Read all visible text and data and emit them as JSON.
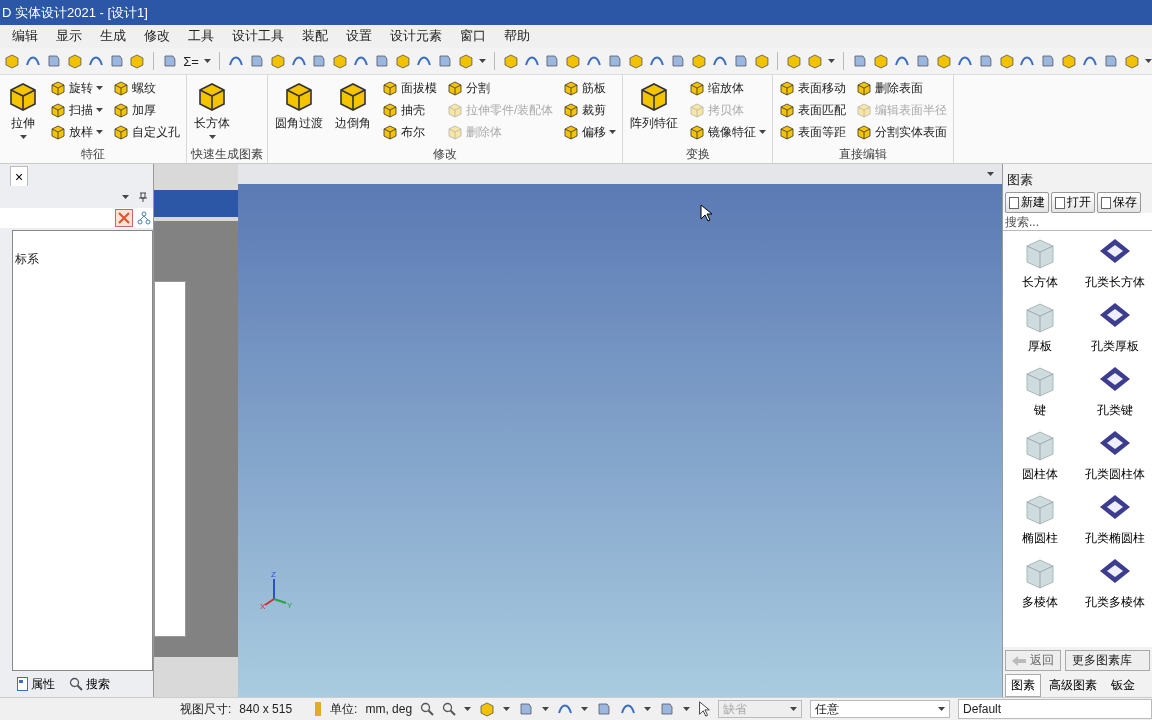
{
  "window": {
    "title": "D 实体设计2021 - [设计1]"
  },
  "menu": [
    "编辑",
    "显示",
    "生成",
    "修改",
    "工具",
    "设计工具",
    "装配",
    "设置",
    "设计元素",
    "窗口",
    "帮助"
  ],
  "toolbar": {
    "sigma_label": "Σ="
  },
  "ribbon": [
    {
      "label": "特征",
      "columns": [
        {
          "kind": "big",
          "items": [
            {
              "label": "拉伸",
              "dropdown": true,
              "disabled": false
            }
          ]
        },
        {
          "kind": "small",
          "items": [
            {
              "label": "旋转",
              "dropdown": true,
              "disabled": false
            },
            {
              "label": "扫描",
              "dropdown": true,
              "disabled": false
            },
            {
              "label": "放样",
              "dropdown": true,
              "disabled": false
            }
          ]
        },
        {
          "kind": "small",
          "items": [
            {
              "label": "螺纹",
              "dropdown": false,
              "disabled": false
            },
            {
              "label": "加厚",
              "dropdown": false,
              "disabled": false
            },
            {
              "label": "自定义孔",
              "dropdown": false,
              "disabled": false
            }
          ]
        }
      ]
    },
    {
      "label": "快速生成图素",
      "columns": [
        {
          "kind": "big",
          "items": [
            {
              "label": "长方体",
              "dropdown": true,
              "disabled": false
            }
          ]
        }
      ]
    },
    {
      "label": "修改",
      "columns": [
        {
          "kind": "big",
          "items": [
            {
              "label": "圆角过渡",
              "dropdown": false,
              "disabled": false
            }
          ]
        },
        {
          "kind": "big",
          "items": [
            {
              "label": "边倒角",
              "dropdown": false,
              "disabled": false
            }
          ]
        },
        {
          "kind": "small",
          "items": [
            {
              "label": "面拔模",
              "dropdown": false,
              "disabled": false
            },
            {
              "label": "抽壳",
              "dropdown": false,
              "disabled": false
            },
            {
              "label": "布尔",
              "dropdown": false,
              "disabled": false
            }
          ]
        },
        {
          "kind": "small",
          "items": [
            {
              "label": "分割",
              "dropdown": false,
              "disabled": false
            },
            {
              "label": "拉伸零件/装配体",
              "dropdown": false,
              "disabled": true
            },
            {
              "label": "删除体",
              "dropdown": false,
              "disabled": true
            }
          ]
        },
        {
          "kind": "small",
          "items": [
            {
              "label": "筋板",
              "dropdown": false,
              "disabled": false
            },
            {
              "label": "裁剪",
              "dropdown": false,
              "disabled": false
            },
            {
              "label": "偏移",
              "dropdown": true,
              "disabled": false
            }
          ]
        }
      ]
    },
    {
      "label": "变换",
      "columns": [
        {
          "kind": "big",
          "items": [
            {
              "label": "阵列特征",
              "dropdown": false,
              "disabled": false
            }
          ]
        },
        {
          "kind": "small",
          "items": [
            {
              "label": "缩放体",
              "dropdown": false,
              "disabled": false
            },
            {
              "label": "拷贝体",
              "dropdown": false,
              "disabled": true
            },
            {
              "label": "镜像特征",
              "dropdown": true,
              "disabled": false
            }
          ]
        }
      ]
    },
    {
      "label": "直接编辑",
      "columns": [
        {
          "kind": "small",
          "items": [
            {
              "label": "表面移动",
              "dropdown": false,
              "disabled": false
            },
            {
              "label": "表面匹配",
              "dropdown": false,
              "disabled": false
            },
            {
              "label": "表面等距",
              "dropdown": false,
              "disabled": false
            }
          ]
        },
        {
          "kind": "small",
          "items": [
            {
              "label": "删除表面",
              "dropdown": false,
              "disabled": false
            },
            {
              "label": "编辑表面半径",
              "dropdown": false,
              "disabled": true
            },
            {
              "label": "分割实体表面",
              "dropdown": false,
              "disabled": false
            }
          ]
        }
      ]
    }
  ],
  "left_panel": {
    "close": "×",
    "tree_items": [
      "标系"
    ],
    "tabs": [
      {
        "label": "属性",
        "selected": false
      },
      {
        "label": "搜索",
        "selected": false
      }
    ]
  },
  "viewport": {
    "axis_labels": {
      "z": "Z",
      "x": "X",
      "y": "Y"
    }
  },
  "right_panel": {
    "title": "图素",
    "buttons": [
      "新建",
      "打开",
      "保存"
    ],
    "search": {
      "placeholder": "搜索..."
    },
    "items": [
      {
        "label": "长方体",
        "kind": "solid"
      },
      {
        "label": "孔类长方体",
        "kind": "hole"
      },
      {
        "label": "厚板",
        "kind": "solid"
      },
      {
        "label": "孔类厚板",
        "kind": "hole"
      },
      {
        "label": "键",
        "kind": "solid"
      },
      {
        "label": "孔类键",
        "kind": "hole"
      },
      {
        "label": "圆柱体",
        "kind": "solid"
      },
      {
        "label": "孔类圆柱体",
        "kind": "hole"
      },
      {
        "label": "椭圆柱",
        "kind": "solid"
      },
      {
        "label": "孔类椭圆柱",
        "kind": "hole"
      },
      {
        "label": "多棱体",
        "kind": "solid"
      },
      {
        "label": "孔类多棱体",
        "kind": "hole"
      }
    ],
    "back": "返回",
    "more": "更多图素库",
    "tabs": [
      {
        "label": "图素",
        "selected": true
      },
      {
        "label": "高级图素",
        "selected": false
      },
      {
        "label": "钣金",
        "selected": false
      }
    ]
  },
  "status_bar": {
    "view_size_label": "视图尺寸:",
    "view_size": "840 x 515",
    "unit_label": "单位:",
    "unit": "mm, deg",
    "style_dropdown": {
      "value": "缺省",
      "disabled": true
    },
    "filter_dropdown": {
      "value": "任意",
      "disabled": false
    },
    "material": "Default"
  }
}
